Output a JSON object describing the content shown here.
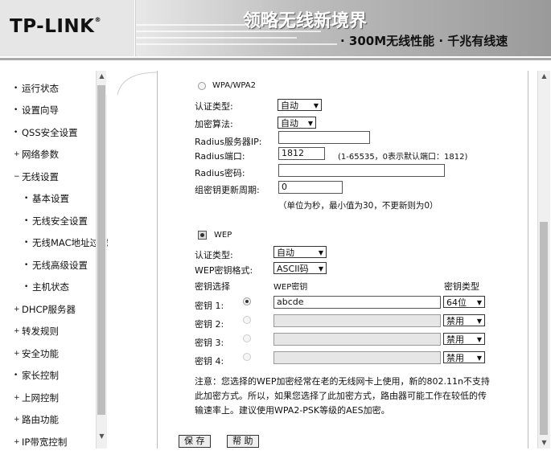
{
  "banner": {
    "logo": "TP-LINK",
    "logo_mark": "®",
    "slogan_main": "领略无线新境界",
    "slogan_sub": "· 300M无线性能  · 千兆有线速"
  },
  "sidebar": {
    "items": [
      {
        "label": "运行状态",
        "marker": "•"
      },
      {
        "label": "设置向导",
        "marker": "•"
      },
      {
        "label": "QSS安全设置",
        "marker": "•"
      },
      {
        "label": "网络参数",
        "marker": "+"
      },
      {
        "label": "无线设置",
        "marker": "−"
      },
      {
        "label": "基本设置",
        "marker": "•"
      },
      {
        "label": "无线安全设置",
        "marker": "•"
      },
      {
        "label": "无线MAC地址过滤",
        "marker": "•"
      },
      {
        "label": "无线高级设置",
        "marker": "•"
      },
      {
        "label": "主机状态",
        "marker": "•"
      },
      {
        "label": "DHCP服务器",
        "marker": "+"
      },
      {
        "label": "转发规则",
        "marker": "+"
      },
      {
        "label": "安全功能",
        "marker": "+"
      },
      {
        "label": "家长控制",
        "marker": "•"
      },
      {
        "label": "上网控制",
        "marker": "+"
      },
      {
        "label": "路由功能",
        "marker": "+"
      },
      {
        "label": "IP带宽控制",
        "marker": "+"
      }
    ]
  },
  "wpa": {
    "option_label": "WPA/WPA2",
    "auth_label": "认证类型:",
    "auth_value": "自动",
    "enc_label": "加密算法:",
    "enc_value": "自动",
    "radius_ip_label": "Radius服务器IP:",
    "radius_ip_value": "",
    "radius_port_label": "Radius端口:",
    "radius_port_value": "1812",
    "radius_port_hint": "(1-65535，0表示默认端口：1812)",
    "radius_pw_label": "Radius密码:",
    "radius_pw_value": "",
    "group_key_label": "组密钥更新周期:",
    "group_key_value": "0",
    "group_key_hint": "（单位为秒，最小值为30，不更新则为0）"
  },
  "wep": {
    "option_label": "WEP",
    "auth_label": "认证类型:",
    "auth_value": "自动",
    "format_label": "WEP密钥格式:",
    "format_value": "ASCII码",
    "col_select": "密钥选择",
    "col_key": "WEP密钥",
    "col_type": "密钥类型",
    "keys": [
      {
        "label": "密钥 1:",
        "value": "abcde",
        "type": "64位"
      },
      {
        "label": "密钥 2:",
        "value": "",
        "type": "禁用"
      },
      {
        "label": "密钥 3:",
        "value": "",
        "type": "禁用"
      },
      {
        "label": "密钥 4:",
        "value": "",
        "type": "禁用"
      }
    ]
  },
  "note": "注意：您选择的WEP加密经常在老的无线网卡上使用，新的802.11n不支持此加密方式。所以，如果您选择了此加密方式，路由器可能工作在较低的传输速率上。建议使用WPA2-PSK等级的AES加密。",
  "buttons": {
    "save": "保 存",
    "help": "帮 助"
  }
}
